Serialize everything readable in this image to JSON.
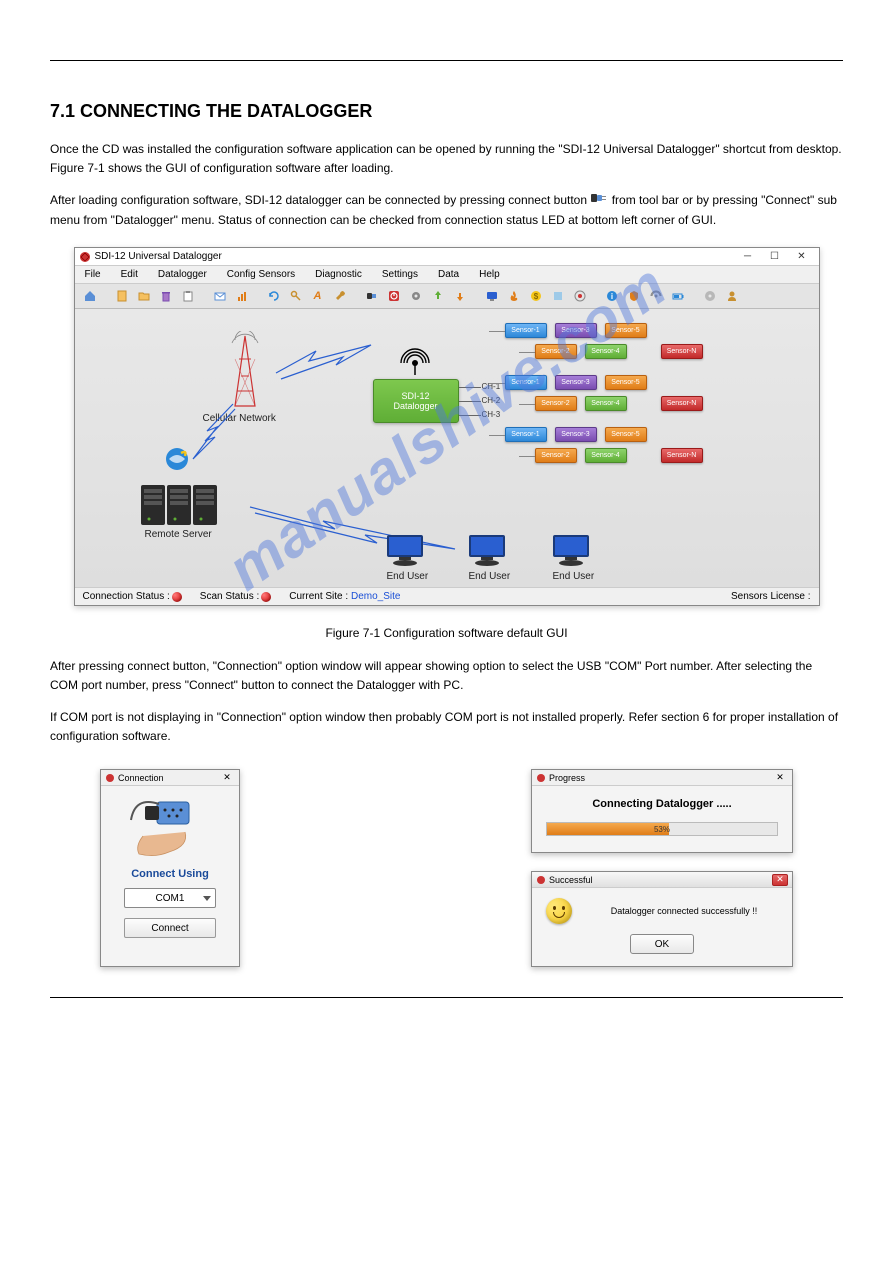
{
  "section_title": "7.1 CONNECTING THE DATALOGGER",
  "para1": "Once the CD was installed the configuration software application can be opened by running the \"SDI-12 Universal Datalogger\" shortcut from desktop. Figure 7-1 shows the GUI of configuration software after loading.",
  "para2_prefix": "After loading configuration software, SDI-12 datalogger can be connected by pressing connect button ",
  "para2_suffix": " from tool bar or by pressing \"Connect\" sub menu from \"Datalogger\" menu. Status of connection can be checked from connection status LED at bottom left corner of GUI.",
  "para3": "After pressing connect button, \"Connection\" option window will appear showing option to select the USB \"COM\" Port number. After selecting the COM port number, press \"Connect\" button to connect the Datalogger with PC.",
  "para4": "If COM port is not displaying in \"Connection\" option window then probably COM port is not installed properly. Refer section 6 for proper installation of configuration software.",
  "figure_caption": "Figure 7-1 Configuration software default GUI",
  "watermark": "manualshive.com",
  "app": {
    "title": "SDI-12 Universal Datalogger",
    "menus": [
      "File",
      "Edit",
      "Datalogger",
      "Config Sensors",
      "Diagnostic",
      "Settings",
      "Data",
      "Help"
    ],
    "diagram": {
      "datalogger_title": "SDI-12",
      "datalogger_sub": "Datalogger",
      "cellular_label": "Cellular Network",
      "server_label": "Remote Server",
      "enduser_label": "End User",
      "channels": [
        "CH-1",
        "CH-2",
        "CH-3"
      ],
      "sensor_labels": {
        "s1": "Sensor-1",
        "s2": "Sensor-2",
        "s3": "Sensor-3",
        "s4": "Sensor-4",
        "s5": "Sensor-5",
        "sn": "Sensor-N"
      }
    },
    "status": {
      "conn_label": "Connection Status :",
      "scan_label": "Scan Status :",
      "site_label": "Current Site :",
      "site_value": "Demo_Site",
      "license_label": "Sensors License :"
    }
  },
  "dialogs": {
    "connection": {
      "title": "Connection",
      "heading": "Connect Using",
      "combo_value": "COM1",
      "button": "Connect"
    },
    "progress": {
      "title": "Progress",
      "label": "Connecting Datalogger .....",
      "percent_text": "53%",
      "percent_value": 53
    },
    "success": {
      "title": "Successful",
      "message": "Datalogger connected successfully !!",
      "ok": "OK"
    }
  }
}
